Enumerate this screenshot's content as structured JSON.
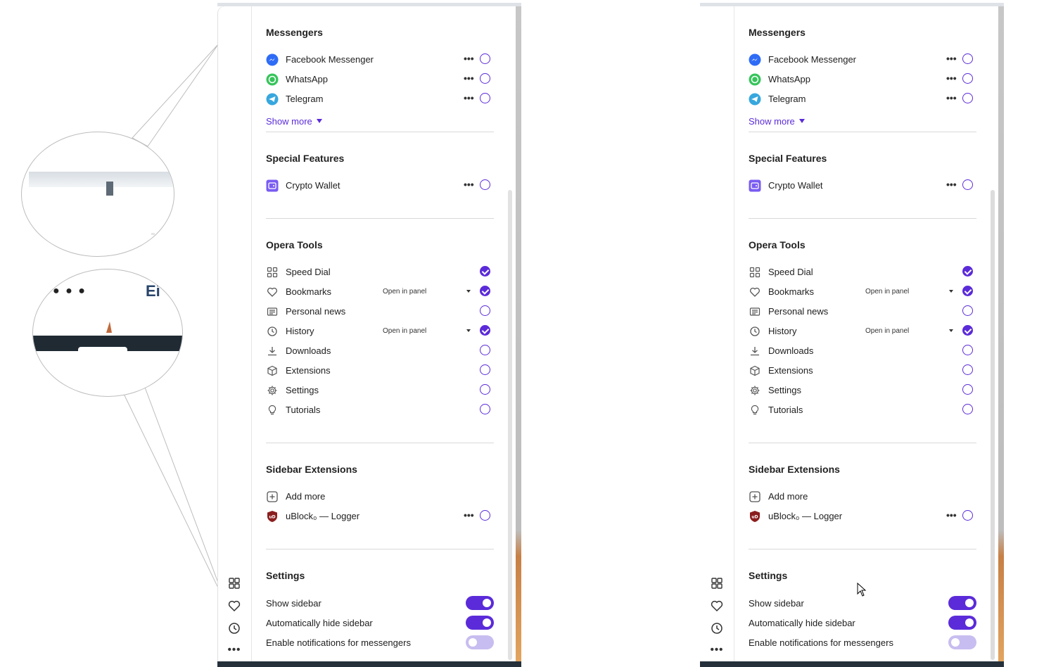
{
  "sections": {
    "messengers": {
      "title": "Messengers",
      "items": [
        {
          "label": "Facebook Messenger",
          "icon": "messenger-icon"
        },
        {
          "label": "WhatsApp",
          "icon": "whatsapp-icon"
        },
        {
          "label": "Telegram",
          "icon": "telegram-icon"
        }
      ],
      "show_more": "Show more"
    },
    "special": {
      "title": "Special Features",
      "items": [
        {
          "label": "Crypto Wallet",
          "icon": "wallet-icon"
        }
      ]
    },
    "tools": {
      "title": "Opera Tools",
      "items": [
        {
          "label": "Speed Dial",
          "mode": "",
          "checked": true
        },
        {
          "label": "Bookmarks",
          "mode": "Open in panel",
          "checked": true
        },
        {
          "label": "Personal news",
          "mode": "",
          "checked": false
        },
        {
          "label": "History",
          "mode": "Open in panel",
          "checked": true
        },
        {
          "label": "Downloads",
          "mode": "",
          "checked": false
        },
        {
          "label": "Extensions",
          "mode": "",
          "checked": false
        },
        {
          "label": "Settings",
          "mode": "",
          "checked": false
        },
        {
          "label": "Tutorials",
          "mode": "",
          "checked": false
        }
      ]
    },
    "extensions": {
      "title": "Sidebar Extensions",
      "add_more": "Add more",
      "items": [
        {
          "label": "uBlock₀ — Logger",
          "icon": "ublock-icon"
        }
      ]
    },
    "settings": {
      "title": "Settings",
      "toggles": [
        {
          "label": "Show sidebar",
          "on": true
        },
        {
          "label": "Automatically hide sidebar",
          "on": true
        },
        {
          "label": "Enable notifications for messengers",
          "on": false
        }
      ]
    }
  },
  "more_glyph": "•••",
  "colors": {
    "accent": "#5b2bd9",
    "accent_light": "#c8bdf0"
  }
}
